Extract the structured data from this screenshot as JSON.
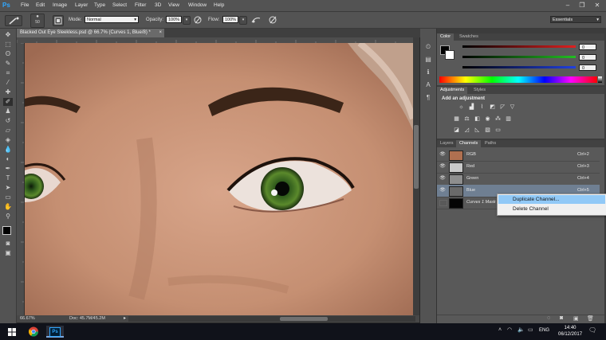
{
  "app": {
    "logo": "Ps"
  },
  "menu": [
    "File",
    "Edit",
    "Image",
    "Layer",
    "Type",
    "Select",
    "Filter",
    "3D",
    "View",
    "Window",
    "Help"
  ],
  "window_controls": {
    "minimize": "–",
    "restore": "❐",
    "close": "✕"
  },
  "options_bar": {
    "brush_size": "50",
    "mode_label": "Mode:",
    "mode_value": "Normal",
    "opacity_label": "Opacity:",
    "opacity_value": "100%",
    "flow_label": "Flow:",
    "flow_value": "100%",
    "workspace": "Essentials"
  },
  "document": {
    "tab_title": "Blacked Out Eye Sleekless.psd @ 66.7% (Curves 1, Blue/8) *",
    "tab_close": "×"
  },
  "status": {
    "zoom": "66.67%",
    "doc_size": "Doc: 45.7M/45.2M"
  },
  "color_panel": {
    "tabs": [
      "Color",
      "Swatches"
    ],
    "values": [
      "0",
      "0",
      "0"
    ],
    "colors": {
      "red": "#e02020",
      "green": "#22c022",
      "blue": "#2040e0"
    }
  },
  "adjustments_panel": {
    "tabs": [
      "Adjustments",
      "Styles"
    ],
    "heading": "Add an adjustment"
  },
  "layers_panel": {
    "tabs": [
      "Layers",
      "Channels",
      "Paths"
    ],
    "channels": [
      {
        "name": "RGB",
        "shortcut": "Ctrl+2"
      },
      {
        "name": "Red",
        "shortcut": "Ctrl+3"
      },
      {
        "name": "Green",
        "shortcut": "Ctrl+4"
      },
      {
        "name": "Blue",
        "shortcut": "Ctrl+5"
      },
      {
        "name": "Curves 1 Mask",
        "shortcut": ""
      }
    ]
  },
  "context_menu": {
    "items": [
      "Duplicate Channel...",
      "Delete Channel"
    ]
  },
  "taskbar": {
    "language": "ENG",
    "time": "14:40",
    "date": "06/12/2017"
  }
}
